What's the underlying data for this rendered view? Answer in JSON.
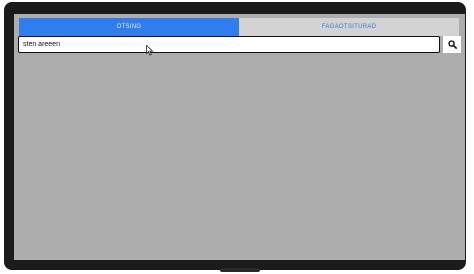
{
  "tabs": [
    {
      "label": "OTSING",
      "active": true
    },
    {
      "label": "FAGAOTSITURAD",
      "active": false
    }
  ],
  "search": {
    "value": "sten areeen",
    "placeholder": ""
  },
  "icons": {
    "search_button": "search-icon",
    "pointer": "mouse-pointer-icon"
  },
  "colors": {
    "tab_active_bg": "#2f7dee",
    "tab_inactive_text": "#3a74c9",
    "screen_bg": "#aeadad",
    "bezel": "#1b1b1b"
  }
}
